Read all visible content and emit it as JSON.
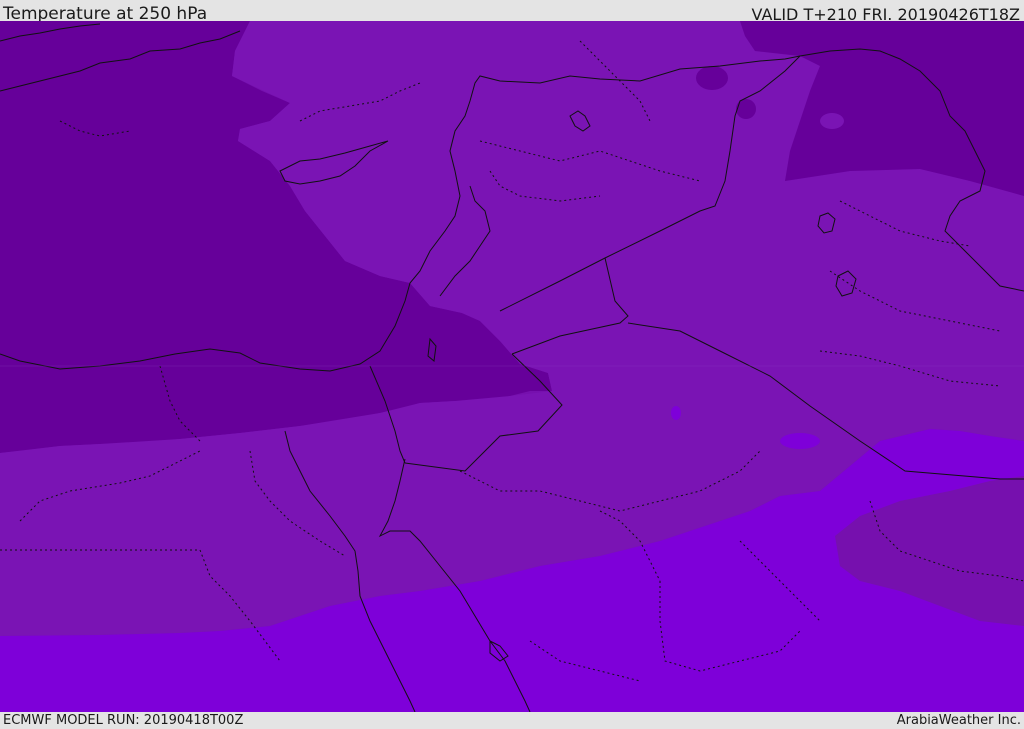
{
  "header": {
    "title": "Temperature at 250 hPa",
    "valid_time": "VALID T+210 FRI. 20190426T18Z"
  },
  "footer": {
    "model_run": "ECMWF MODEL RUN: 20190418T00Z",
    "credit": "ArabiaWeather Inc."
  },
  "colors": {
    "coldest": "#66009a",
    "cold": "#7610ae",
    "mild": "#7a14b4",
    "warm": "#7e00d9",
    "lines": "#111111"
  }
}
